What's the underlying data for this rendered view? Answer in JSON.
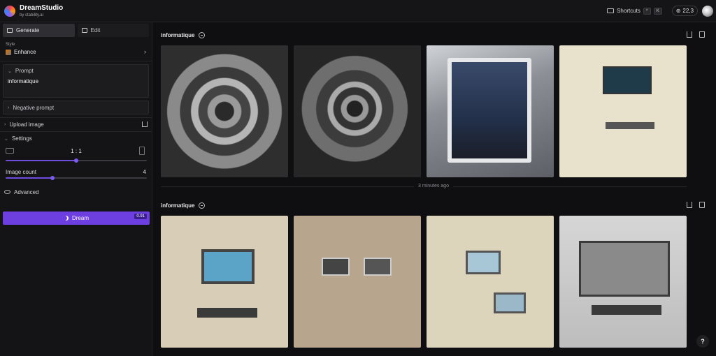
{
  "app": {
    "title": "DreamStudio",
    "subtitle": "by stability.ai"
  },
  "topbar": {
    "shortcuts_label": "Shortcuts",
    "shortcut_keys": [
      "^",
      "K"
    ],
    "credits": "22,3"
  },
  "sidebar": {
    "tabs": [
      {
        "label": "Generate",
        "icon": "grid-icon",
        "active": true
      },
      {
        "label": "Edit",
        "icon": "edit-icon",
        "active": false
      }
    ],
    "style": {
      "label": "Style",
      "value": "Enhance"
    },
    "prompt": {
      "label": "Prompt",
      "value": "informatique"
    },
    "negative_prompt": {
      "label": "Negative prompt"
    },
    "upload_image": {
      "label": "Upload image"
    },
    "settings": {
      "label": "Settings",
      "aspect_ratio": "1 : 1",
      "aspect_ratio_position": 0.5,
      "image_count_label": "Image count",
      "image_count": "4",
      "image_count_position": 0.33
    },
    "advanced": {
      "label": "Advanced"
    },
    "dream_button": {
      "label": "Dream",
      "cost": "0.91"
    }
  },
  "main": {
    "batches": [
      {
        "prompt": "informatique",
        "images": [
          {
            "name": "circular-mechanical-art"
          },
          {
            "name": "circuit-board-gears"
          },
          {
            "name": "open-pc-case"
          },
          {
            "name": "computer-infographic"
          }
        ]
      },
      {
        "prompt": "informatique",
        "images": [
          {
            "name": "computer-collage-color"
          },
          {
            "name": "computer-collage-brown"
          },
          {
            "name": "computer-collage-beige"
          },
          {
            "name": "computer-sketch"
          }
        ]
      }
    ],
    "timestamp": "3 minutes ago",
    "help_label": "?"
  },
  "colors": {
    "accent": "#6d3fe0",
    "background": "#0f0f11",
    "sidebar": "#141416"
  }
}
